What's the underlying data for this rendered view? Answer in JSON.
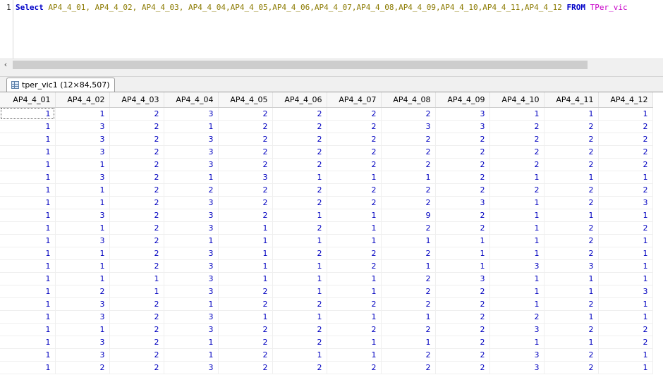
{
  "editor": {
    "line_number": "1",
    "sql": {
      "select_kw": "Select",
      "columns": "AP4_4_01, AP4_4_02, AP4_4_03, AP4_4_04,AP4_4_05,AP4_4_06,AP4_4_07,AP4_4_08,AP4_4_09,AP4_4_10,AP4_4_11,AP4_4_12",
      "from_kw": "FROM",
      "table": "TPer_vic"
    }
  },
  "scrollbar": {
    "left_arrow": "‹"
  },
  "result_tab": {
    "label": "tper_vic1 (12×84,507)",
    "icon": "grid-icon"
  },
  "grid": {
    "columns": [
      "AP4_4_01",
      "AP4_4_02",
      "AP4_4_03",
      "AP4_4_04",
      "AP4_4_05",
      "AP4_4_06",
      "AP4_4_07",
      "AP4_4_08",
      "AP4_4_09",
      "AP4_4_10",
      "AP4_4_11",
      "AP4_4_12"
    ],
    "rows": [
      [
        "1",
        "1",
        "2",
        "3",
        "2",
        "2",
        "2",
        "2",
        "3",
        "1",
        "1",
        "1"
      ],
      [
        "1",
        "3",
        "2",
        "1",
        "2",
        "2",
        "2",
        "3",
        "3",
        "2",
        "2",
        "2"
      ],
      [
        "1",
        "3",
        "2",
        "3",
        "2",
        "2",
        "2",
        "2",
        "2",
        "2",
        "2",
        "2"
      ],
      [
        "1",
        "3",
        "2",
        "3",
        "2",
        "2",
        "2",
        "2",
        "2",
        "2",
        "2",
        "2"
      ],
      [
        "1",
        "1",
        "2",
        "3",
        "2",
        "2",
        "2",
        "2",
        "2",
        "2",
        "2",
        "2"
      ],
      [
        "1",
        "3",
        "2",
        "1",
        "3",
        "1",
        "1",
        "1",
        "2",
        "1",
        "1",
        "1"
      ],
      [
        "1",
        "1",
        "2",
        "2",
        "2",
        "2",
        "2",
        "2",
        "2",
        "2",
        "2",
        "2"
      ],
      [
        "1",
        "1",
        "2",
        "3",
        "2",
        "2",
        "2",
        "2",
        "3",
        "1",
        "2",
        "3"
      ],
      [
        "1",
        "3",
        "2",
        "3",
        "2",
        "1",
        "1",
        "9",
        "2",
        "1",
        "1",
        "1"
      ],
      [
        "1",
        "1",
        "2",
        "3",
        "1",
        "2",
        "1",
        "2",
        "2",
        "1",
        "2",
        "2"
      ],
      [
        "1",
        "3",
        "2",
        "1",
        "1",
        "1",
        "1",
        "1",
        "1",
        "1",
        "2",
        "1"
      ],
      [
        "1",
        "1",
        "2",
        "3",
        "1",
        "2",
        "2",
        "2",
        "1",
        "1",
        "2",
        "1"
      ],
      [
        "1",
        "1",
        "2",
        "3",
        "1",
        "1",
        "2",
        "1",
        "1",
        "3",
        "3",
        "1"
      ],
      [
        "1",
        "1",
        "1",
        "3",
        "1",
        "1",
        "1",
        "2",
        "3",
        "1",
        "1",
        "1"
      ],
      [
        "1",
        "2",
        "1",
        "3",
        "2",
        "1",
        "1",
        "2",
        "2",
        "1",
        "1",
        "3"
      ],
      [
        "1",
        "3",
        "2",
        "1",
        "2",
        "2",
        "2",
        "2",
        "2",
        "1",
        "2",
        "1"
      ],
      [
        "1",
        "3",
        "2",
        "3",
        "1",
        "1",
        "1",
        "1",
        "2",
        "2",
        "1",
        "1"
      ],
      [
        "1",
        "1",
        "2",
        "3",
        "2",
        "2",
        "2",
        "2",
        "2",
        "3",
        "2",
        "2"
      ],
      [
        "1",
        "3",
        "2",
        "1",
        "2",
        "2",
        "1",
        "1",
        "2",
        "1",
        "1",
        "2"
      ],
      [
        "1",
        "3",
        "2",
        "1",
        "2",
        "1",
        "1",
        "2",
        "2",
        "3",
        "2",
        "1"
      ],
      [
        "1",
        "2",
        "2",
        "3",
        "2",
        "2",
        "2",
        "2",
        "2",
        "3",
        "2",
        "1"
      ]
    ]
  },
  "colors": {
    "keyword": "#0000c8",
    "column_names": "#8b7a00",
    "table_name": "#c800c8",
    "cell_values": "#0000c0"
  }
}
